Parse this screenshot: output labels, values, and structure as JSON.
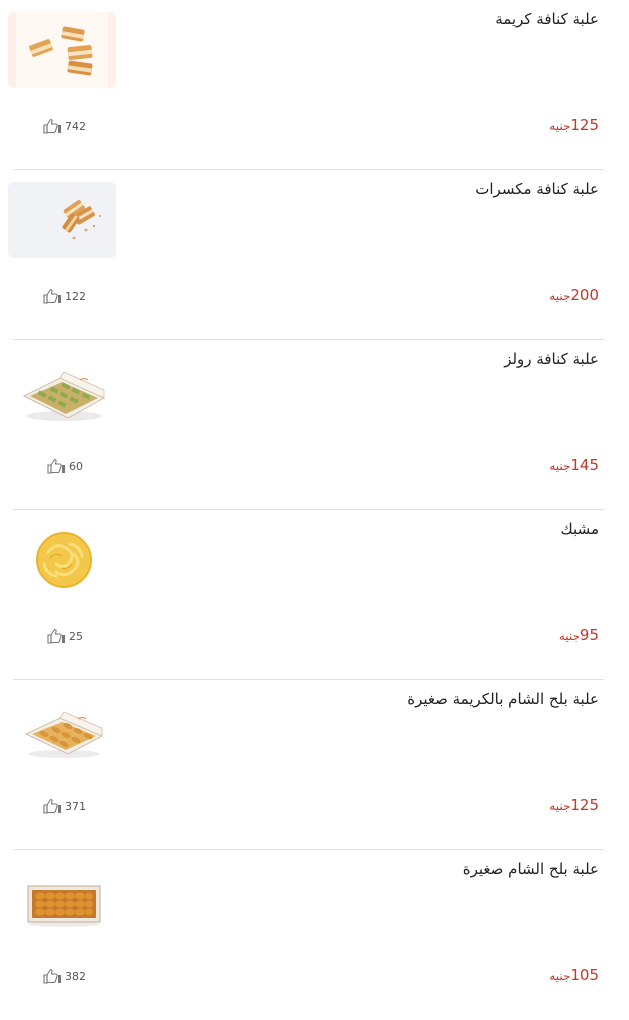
{
  "products": [
    {
      "name": "علبة كنافة كريمة",
      "price": "125",
      "currency": "جنيه",
      "likes": "742",
      "image": "kunafa-cream-pieces"
    },
    {
      "name": "علبة كنافة مكسرات",
      "price": "200",
      "currency": "جنيه",
      "likes": "122",
      "image": "kunafa-nuts-pieces"
    },
    {
      "name": "علبة كنافة رولز",
      "price": "145",
      "currency": "جنيه",
      "likes": "60",
      "image": "kunafa-rolls-box"
    },
    {
      "name": "مشبك",
      "price": "95",
      "currency": "جنيه",
      "likes": "25",
      "image": "mushabak"
    },
    {
      "name": "علبة بلح الشام بالكريمة صغيرة",
      "price": "125",
      "currency": "جنيه",
      "likes": "371",
      "image": "balah-cream-box"
    },
    {
      "name": "علبة بلح الشام صغيرة",
      "price": "105",
      "currency": "جنيه",
      "likes": "382",
      "image": "balah-box"
    }
  ],
  "colors": {
    "price": "#c0392b",
    "divider": "#e2e2e2",
    "icon": "#777777"
  },
  "icons": {
    "like": "thumbs-up-icon"
  }
}
